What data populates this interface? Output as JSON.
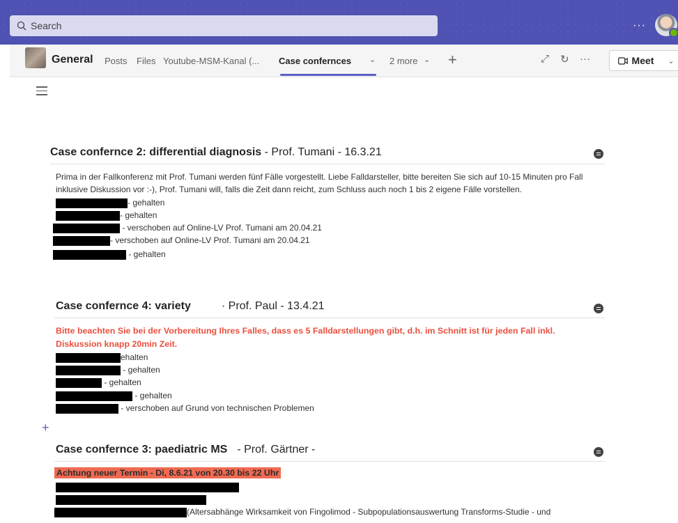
{
  "search": {
    "placeholder": "Search"
  },
  "header": {
    "channel": "General",
    "tabs": [
      "Posts",
      "Files",
      "Youtube-MSM-Kanal (...",
      "Case confernces",
      "2 more"
    ],
    "meet_label": "Meet"
  },
  "sections": [
    {
      "title_bold": "Case confernce 2:  differential diagnosis",
      "title_rest": " - Prof. Tumani - 16.3.21",
      "intro": "Prima in der Fallkonferenz mit Prof. Tumani werden fünf Fälle vorgestellt. Liebe Falldarsteller, bitte bereiten Sie sich auf 10-15 Minuten pro Fall inklusive Diskussion vor :-), Prof. Tumani will, falls die Zeit dann reicht, zum Schluss auch noch 1 bis 2 eigene Fälle vorstellen.",
      "items": [
        "- gehalten",
        "- gehalten",
        " - verschoben auf Online-LV Prof. Tumani am 20.04.21",
        "- verschoben auf Online-LV Prof. Tumani am 20.04.21",
        " - gehalten"
      ]
    },
    {
      "title_bold": "Case confernce 4:  variety",
      "title_rest": "· Prof. Paul - 13.4.21",
      "notice": "Bitte beachten Sie bei der Vorbereitung Ihres Falles, dass es 5 Falldarstellungen gibt, d.h. im Schnitt ist für jeden Fall inkl. Diskussion knapp 20min Zeit.",
      "items": [
        "ehalten",
        " - gehalten",
        " - gehalten",
        " - gehalten",
        " - verschoben auf Grund von technischen Problemen"
      ]
    },
    {
      "title_bold": "Case confernce 3:  paediatric MS",
      "title_rest": "- Prof. Gärtner -",
      "highlight": "Achtung neuer Termin - Di, 8.6.21 von 20.30 bis 22 Uhr",
      "item_last": "(Altersabhänge Wirksamkeit von Fingolimod - Subpopulationsauswertung Transforms-Studie - und"
    }
  ]
}
